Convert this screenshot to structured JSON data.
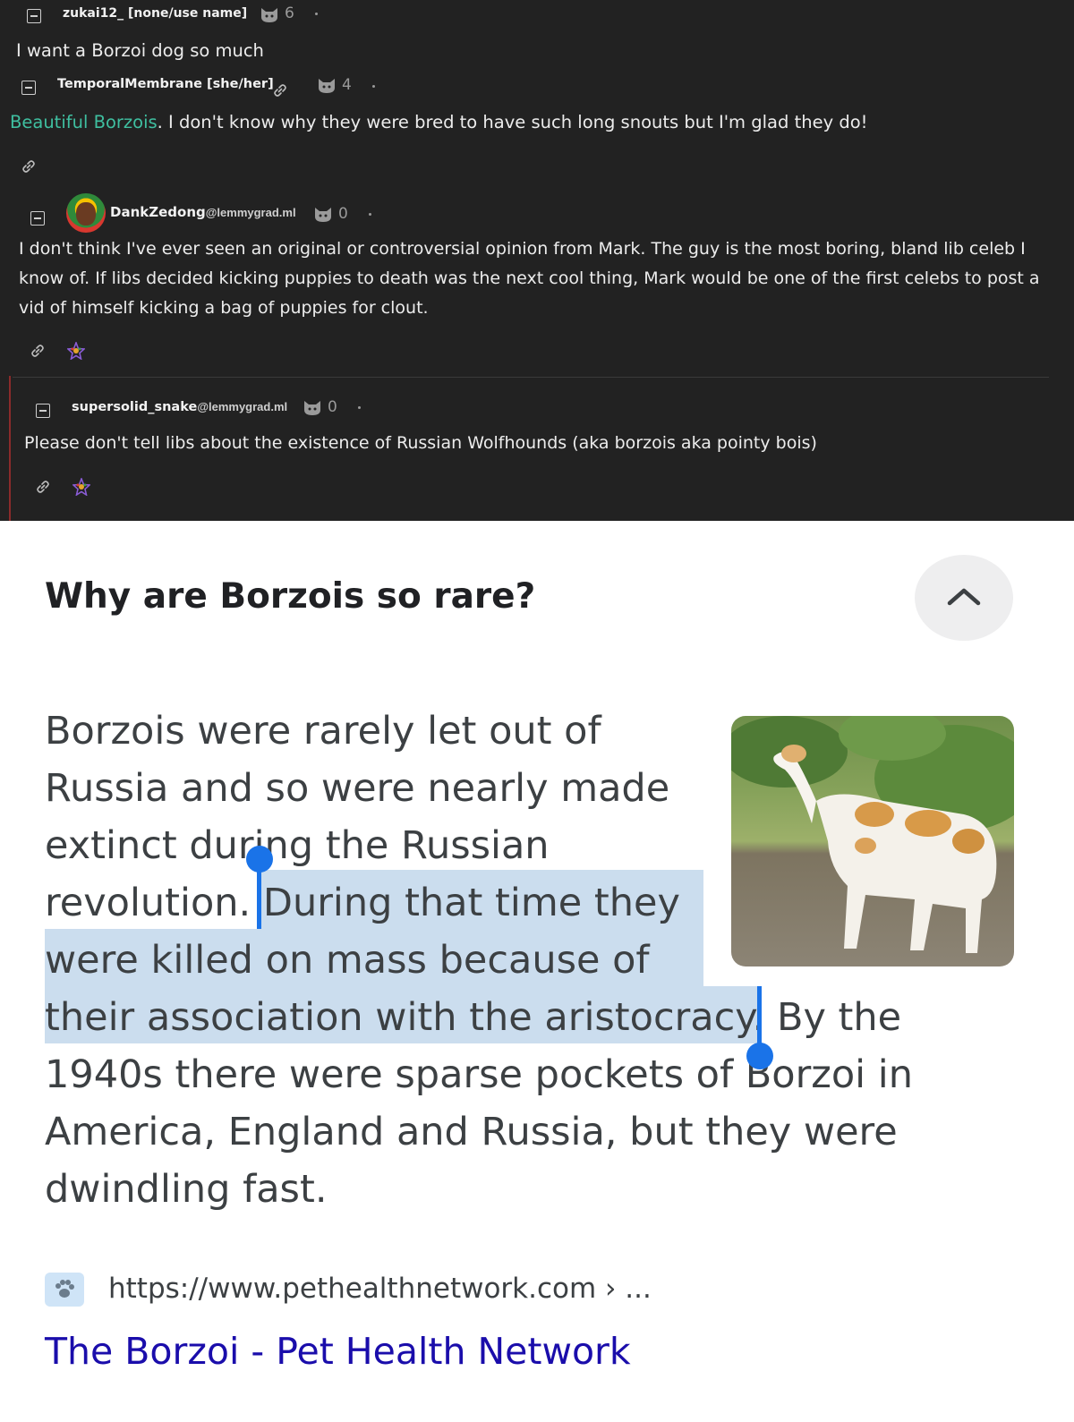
{
  "forum": {
    "comments": [
      {
        "username": "zukai12_ [none/use name]",
        "instance": "",
        "score": "6",
        "body": [
          "I want a Borzoi dog so much"
        ]
      },
      {
        "username": "TemporalMembrane [she/her]",
        "instance": "",
        "score": "4",
        "greentext": "Beautiful Borzois",
        "body": [
          ". I don't know why they were bred to have such long snouts but I'm glad they do!"
        ]
      },
      {
        "username": "DankZedong",
        "instance": "@lemmygrad.ml",
        "score": "0",
        "body": [
          "I don't think I've ever seen an original or controversial opinion from Mark. The guy is the most boring, bland lib celeb I",
          "know of. If libs decided kicking puppies to death was the next cool thing, Mark would be one of the first celebs to post a",
          "vid of himself kicking a bag of puppies for clout."
        ]
      },
      {
        "username": "supersolid_snake",
        "instance": "@lemmygrad.ml",
        "score": "0",
        "body": [
          "Please don't tell libs about the existence of Russian Wolfhounds (aka borzois aka pointy bois)"
        ]
      }
    ],
    "icons": {
      "collapse": "minus-square-icon",
      "link": "link-icon",
      "score": "cat-face-icon",
      "fediverse": "fediverse-star-icon"
    },
    "colors": {
      "background": "#222222",
      "greentext": "#3fbfa0",
      "thread_line": "#8b2b2b"
    }
  },
  "card": {
    "question": "Why are Borzois so rare?",
    "collapse_icon": "chevron-up-icon",
    "answer_lines": [
      {
        "plain": "Borzois were rarely let out of"
      },
      {
        "plain": "Russia and so were nearly made"
      },
      {
        "plain": "extinct during the Russian"
      },
      {
        "plain": "revolution. ",
        "highlight": "During that time they"
      },
      {
        "highlight": "were killed on mass because of"
      },
      {
        "highlight": "their association with the aristocracy",
        "plain_after": ". By the"
      },
      {
        "plain": "1940s there were sparse pockets of Borzoi in"
      },
      {
        "plain": "America, England and Russia, but they were"
      },
      {
        "plain": "dwindling fast."
      }
    ],
    "image_icon": "borzoi-dog-photo",
    "source_url": "https://www.pethealthnetwork.com",
    "source_url_suffix": " › ...",
    "source_title": "The Borzoi - Pet Health Network",
    "favicon_icon": "paw-print-icon",
    "colors": {
      "highlight": "#cbddee",
      "handle": "#1a73e8",
      "link": "#1a0dab"
    }
  }
}
